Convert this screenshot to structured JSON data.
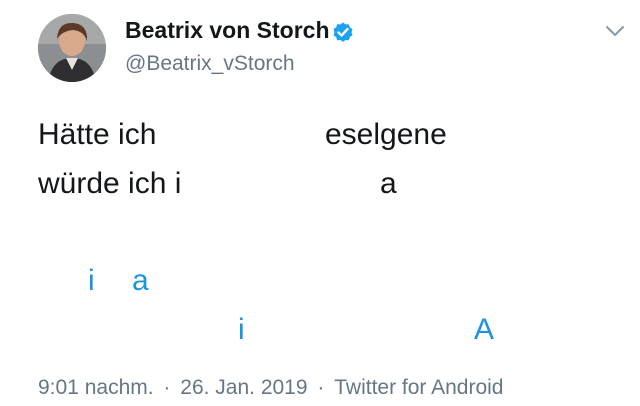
{
  "author": {
    "display_name": "Beatrix von Storch",
    "handle": "@Beatrix_vStorch",
    "verified_icon": "verified-badge-icon",
    "avatar_icon": "avatar"
  },
  "menu": {
    "icon": "chevron-down-icon"
  },
  "tweet_text": {
    "line1_part1": "Hätte ich",
    "line1_part2": "eselgene",
    "line2_part1": "würde ich i",
    "line2_part2": "a"
  },
  "links": {
    "line3_part1": "i",
    "line3_part2": "a",
    "line4_part1": "i",
    "line4_part2": "A"
  },
  "meta": {
    "time": "9:01 nachm.",
    "separator": "·",
    "date": "26. Jan. 2019",
    "source": "Twitter for Android"
  },
  "colors": {
    "link": "#1b95e0",
    "verified": "#1da1f2",
    "secondary_text": "#657786"
  }
}
